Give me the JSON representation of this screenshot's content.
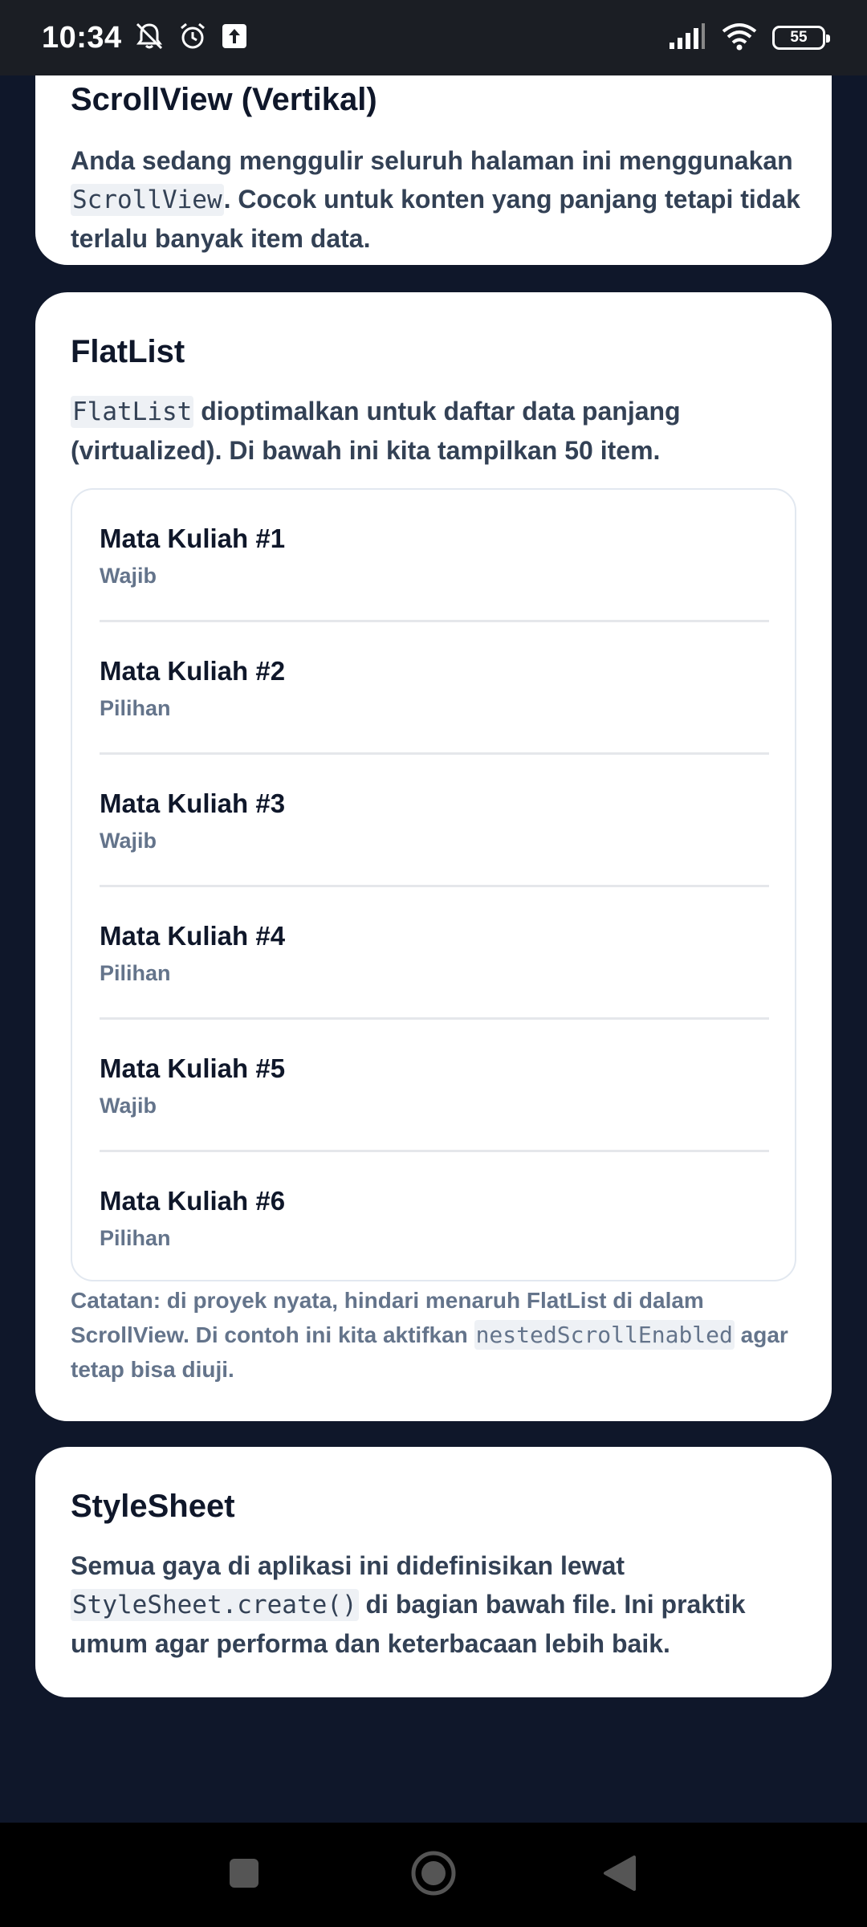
{
  "status_bar": {
    "time": "10:34",
    "battery": "55",
    "icons": [
      "notifications-off-icon",
      "alarm-icon",
      "upload-icon",
      "signal-icon",
      "wifi-icon",
      "battery-icon"
    ]
  },
  "cards": {
    "scrollview": {
      "title": "ScrollView (Vertikal)",
      "text_before": "Anda sedang menggulir seluruh halaman ini menggunakan ",
      "code": "ScrollView",
      "text_after": ". Cocok untuk konten yang panjang tetapi tidak terlalu banyak item data."
    },
    "flatlist": {
      "title": "FlatList",
      "code": "FlatList",
      "text_after": " dioptimalkan untuk daftar data panjang (virtualized). Di bawah ini kita tampilkan 50 item.",
      "items": [
        {
          "title": "Mata Kuliah #1",
          "type": "Wajib"
        },
        {
          "title": "Mata Kuliah #2",
          "type": "Pilihan"
        },
        {
          "title": "Mata Kuliah #3",
          "type": "Wajib"
        },
        {
          "title": "Mata Kuliah #4",
          "type": "Pilihan"
        },
        {
          "title": "Mata Kuliah #5",
          "type": "Wajib"
        },
        {
          "title": "Mata Kuliah #6",
          "type": "Pilihan"
        }
      ],
      "note_before": "Catatan: di proyek nyata, hindari menaruh FlatList di dalam ScrollView. Di contoh ini kita aktifkan ",
      "note_code": "nestedScrollEnabled",
      "note_after": " agar tetap bisa diuji."
    },
    "stylesheet": {
      "title": "StyleSheet",
      "text_before": "Semua gaya di aplikasi ini didefinisikan lewat ",
      "code": "StyleSheet.create()",
      "text_after": " di bagian bawah file. Ini praktik umum agar performa dan keterbacaan lebih baik."
    }
  },
  "nav_bar": {
    "buttons": [
      "recents-square-icon",
      "home-circle-icon",
      "back-triangle-icon"
    ]
  },
  "colors": {
    "background": "#0f172a",
    "card": "#ffffff",
    "title": "#0f172a",
    "text": "#334155",
    "muted": "#64748b"
  }
}
